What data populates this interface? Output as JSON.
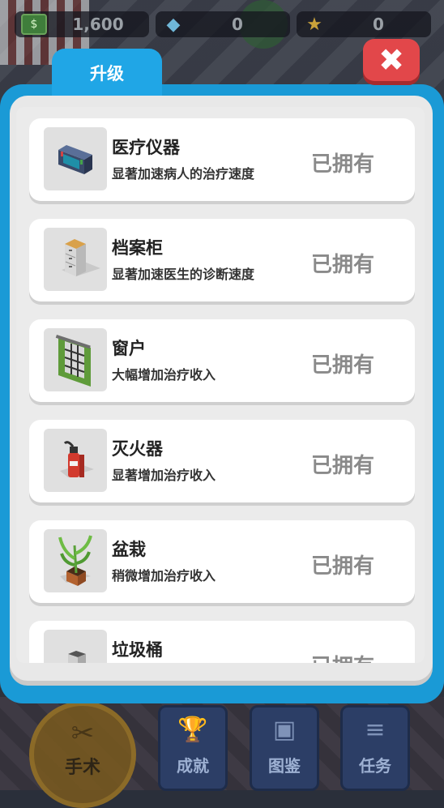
{
  "currencies": [
    {
      "name": "cash",
      "icon": "cash-icon",
      "value": "1,600"
    },
    {
      "name": "gems",
      "icon": "gem-icon",
      "value": "0"
    },
    {
      "name": "stars",
      "icon": "star-icon",
      "value": "0"
    }
  ],
  "modal": {
    "tab_label": "升级",
    "close_glyph": "✖",
    "items": [
      {
        "title": "医疗仪器",
        "desc": "显著加速病人的治疗速度",
        "status": "已拥有",
        "icon": "medical-monitor-icon"
      },
      {
        "title": "档案柜",
        "desc": "显著加速医生的诊断速度",
        "status": "已拥有",
        "icon": "file-cabinet-icon"
      },
      {
        "title": "窗户",
        "desc": "大幅增加治疗收入",
        "status": "已拥有",
        "icon": "window-icon"
      },
      {
        "title": "灭火器",
        "desc": "显著增加治疗收入",
        "status": "已拥有",
        "icon": "fire-extinguisher-icon"
      },
      {
        "title": "盆栽",
        "desc": "稍微增加治疗收入",
        "status": "已拥有",
        "icon": "potted-plant-icon"
      },
      {
        "title": "垃圾桶",
        "desc": "",
        "status": "已拥有",
        "icon": "trash-can-icon"
      }
    ]
  },
  "bottom_nav": {
    "surgery": "手术",
    "achievements": "成就",
    "guide": "图鉴",
    "tasks": "任务"
  },
  "colors": {
    "modal_blue": "#1a9ad6",
    "tab_blue": "#20a6e6",
    "close_red": "#e2474a",
    "owned_gray": "#8a8a8a"
  }
}
